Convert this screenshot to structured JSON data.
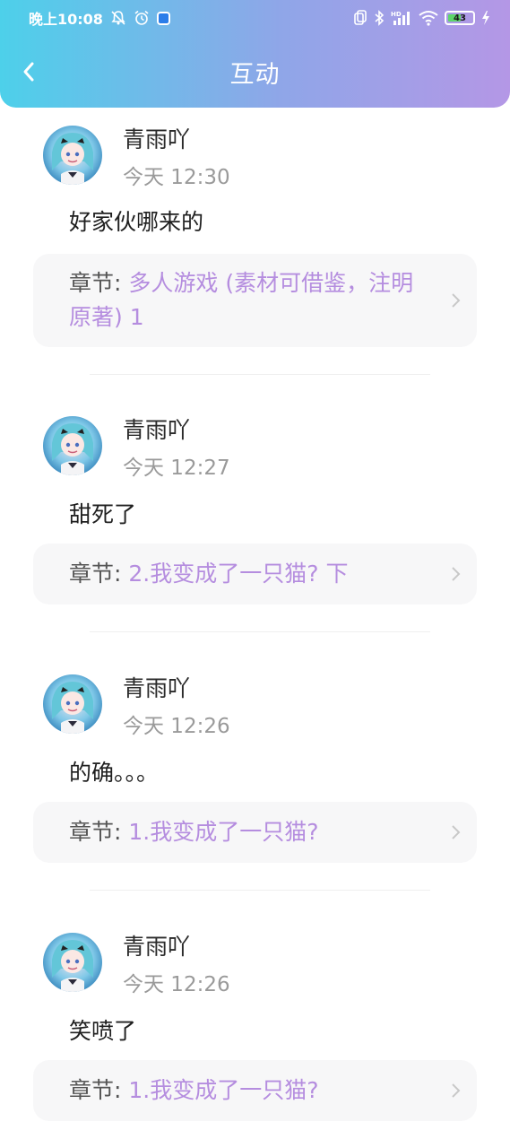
{
  "status_bar": {
    "time": "晚上10:08",
    "battery": "43",
    "icons": [
      "mute-bell-icon",
      "alarm-icon",
      "app-notification-icon",
      "nfc-icon",
      "bluetooth-icon",
      "hd-signal-icon",
      "wifi-icon",
      "battery-icon",
      "charging-icon"
    ]
  },
  "header": {
    "title": "互动",
    "back_icon": "chevron-left-icon"
  },
  "colors": {
    "gradient_start": "#4dd0ea",
    "gradient_end": "#b497e6",
    "chapter_link": "#b58ddf",
    "timestamp": "#9a9a9a",
    "chapter_bg": "#f7f7f8"
  },
  "comments": [
    {
      "user": "青雨吖",
      "time": "今天 12:30",
      "text": "好家伙哪来的",
      "chapter_prefix": "章节: ",
      "chapter": "多人游戏 (素材可借鉴，注明原著) 1"
    },
    {
      "user": "青雨吖",
      "time": "今天 12:27",
      "text": "甜死了",
      "chapter_prefix": "章节: ",
      "chapter": "2.我变成了一只猫? 下"
    },
    {
      "user": "青雨吖",
      "time": "今天 12:26",
      "text": "的确。。。",
      "chapter_prefix": "章节: ",
      "chapter": "1.我变成了一只猫?"
    },
    {
      "user": "青雨吖",
      "time": "今天 12:26",
      "text": "笑喷了",
      "chapter_prefix": "章节: ",
      "chapter": "1.我变成了一只猫?"
    }
  ]
}
